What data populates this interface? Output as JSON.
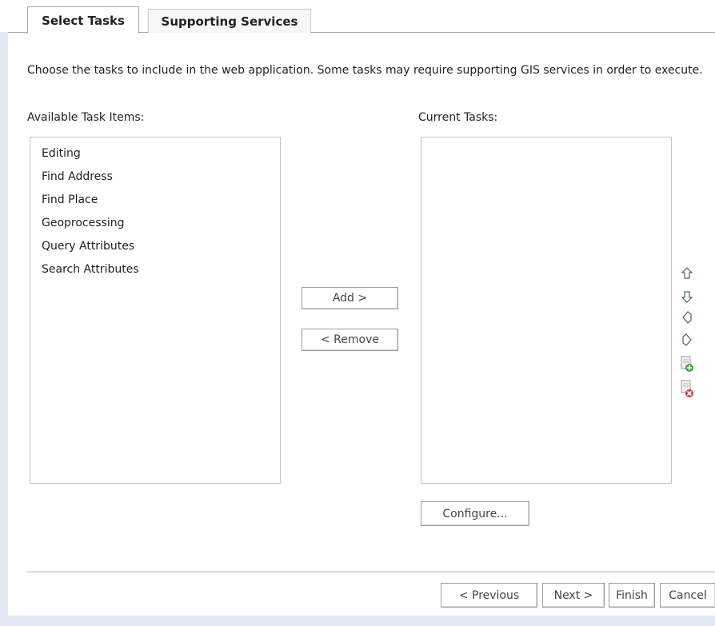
{
  "tabs": [
    {
      "label": "Select Tasks",
      "active": true
    },
    {
      "label": "Supporting Services",
      "active": false
    }
  ],
  "instructions": "Choose the tasks to include in the web application. Some tasks may require supporting GIS services in order to execute.",
  "available": {
    "label": "Available Task Items:",
    "items": [
      "Editing",
      "Find Address",
      "Find Place",
      "Geoprocessing",
      "Query Attributes",
      "Search Attributes"
    ]
  },
  "current": {
    "label": "Current Tasks:",
    "items": []
  },
  "buttons": {
    "add": "Add >",
    "remove": "< Remove",
    "configure": "Configure...",
    "previous": "< Previous",
    "next": "Next >",
    "finish": "Finish",
    "cancel": "Cancel"
  },
  "side_icons": [
    "move-up-icon",
    "move-down-icon",
    "move-left-icon",
    "move-right-icon",
    "add-task-icon",
    "remove-task-icon"
  ],
  "colors": {
    "accent_green": "#3aa63a",
    "accent_red": "#d23a3a",
    "border": "#c4c4c4"
  }
}
